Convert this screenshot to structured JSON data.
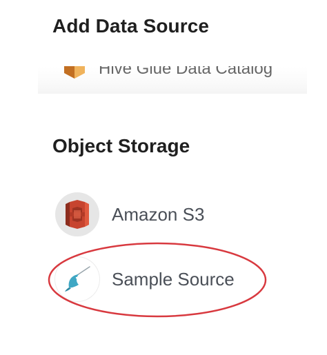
{
  "dialog": {
    "title": "Add Data Source"
  },
  "partial_item": {
    "label": "Hive Glue Data Catalog"
  },
  "object_storage": {
    "section_title": "Object Storage",
    "items": [
      {
        "label": "Amazon S3",
        "icon": "amazon-s3-icon"
      },
      {
        "label": "Sample Source",
        "icon": "narwhal-icon"
      }
    ]
  },
  "colors": {
    "highlight": "#d8393f",
    "s3_red": "#c7442f",
    "narwhal_teal": "#3fa7c4"
  }
}
